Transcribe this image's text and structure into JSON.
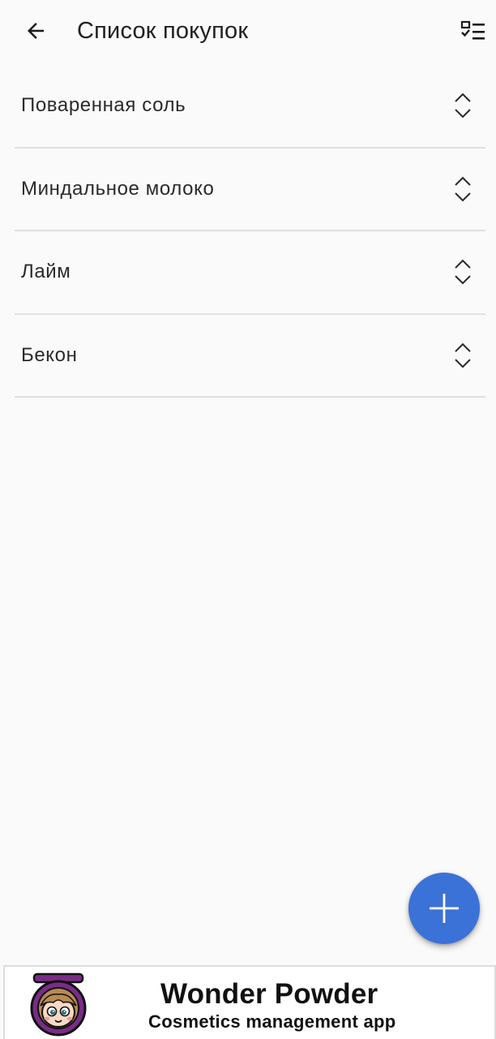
{
  "header": {
    "back_icon": "arrow-back-icon",
    "title": "Список покупок",
    "action_icon": "checklist-icon"
  },
  "shopping_list": {
    "items": [
      {
        "label": "Поваренная соль",
        "icon": "reorder-icon"
      },
      {
        "label": "Миндальное молоко",
        "icon": "reorder-icon"
      },
      {
        "label": "Лайм",
        "icon": "reorder-icon"
      },
      {
        "label": "Бекон",
        "icon": "reorder-icon"
      }
    ]
  },
  "fab": {
    "icon": "plus-icon",
    "color": "#3a72d8"
  },
  "ad": {
    "title": "Wonder Powder",
    "subtitle": "Cosmetics management app",
    "logo_icon": "powder-compact-face-logo"
  }
}
